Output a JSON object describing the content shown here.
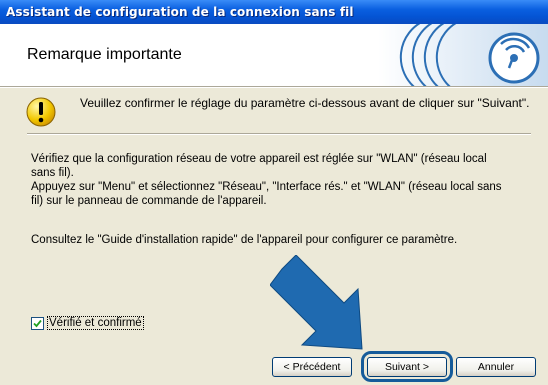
{
  "window": {
    "title": "Assistant de configuration de la connexion sans fil"
  },
  "header": {
    "title": "Remarque importante"
  },
  "warning": {
    "text": "Veuillez confirmer le réglage du paramètre ci-dessous avant de cliquer sur \"Suivant\"."
  },
  "body": {
    "para1": "Vérifiez que la configuration réseau de votre appareil est réglée sur \"WLAN\" (réseau local sans fil).",
    "para2": "Appuyez sur \"Menu\" et sélectionnez \"Réseau\", \"Interface rés.\" et \"WLAN\" (réseau local sans fil) sur le panneau de commande de l'appareil.",
    "para3": "Consultez le \"Guide d'installation rapide\" de l'appareil pour configurer ce paramètre."
  },
  "checkbox": {
    "label": "Vérifié et confirmé",
    "checked": true
  },
  "buttons": {
    "back": "< Précédent",
    "next": "Suivant >",
    "cancel": "Annuler"
  },
  "colors": {
    "titlebar": "#0a5fe0",
    "accent": "#155b9a",
    "arrow": "#1f6ab0"
  }
}
